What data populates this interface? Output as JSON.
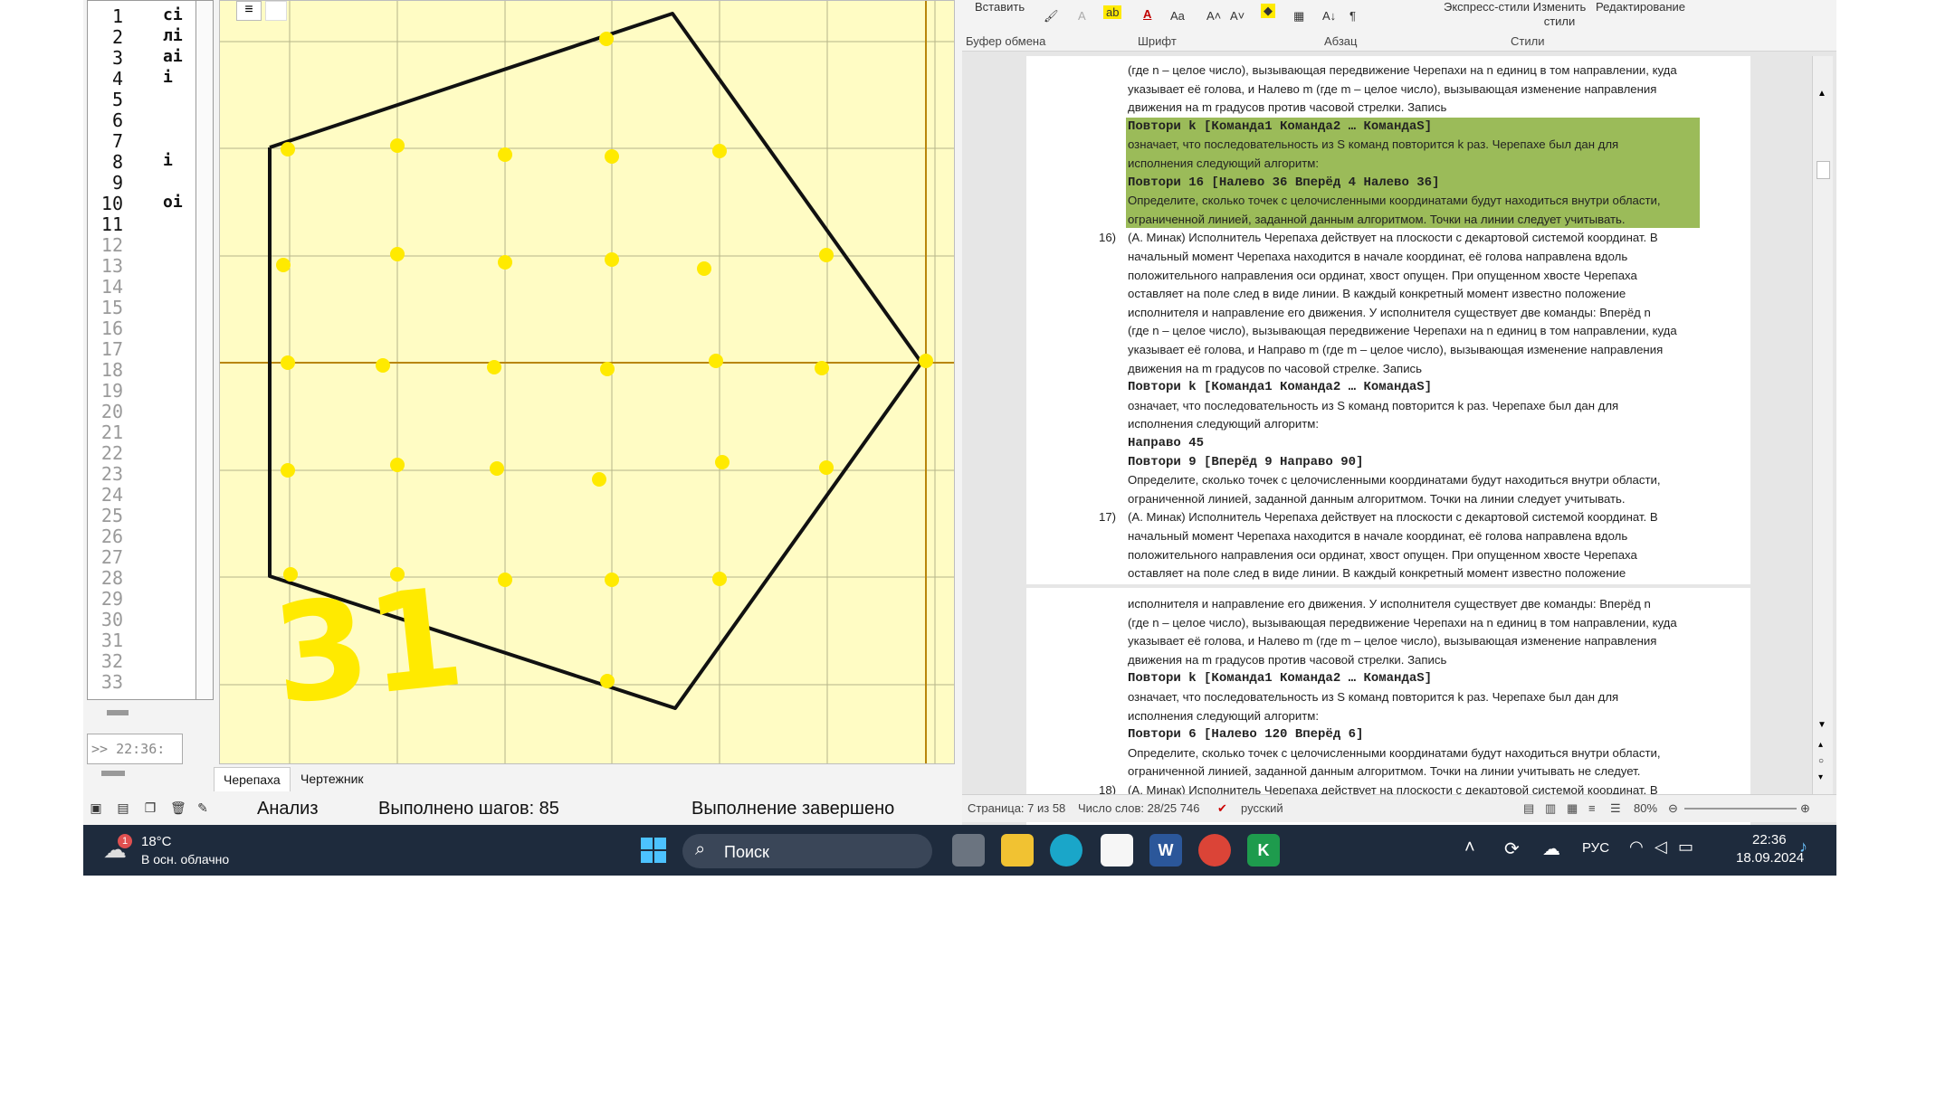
{
  "kumir": {
    "line_numbers": [
      "1",
      "2",
      "3",
      "4",
      "5",
      "6",
      "7",
      "8",
      "9",
      "10",
      "11",
      "12",
      "13",
      "14",
      "15",
      "16",
      "17",
      "18",
      "19",
      "20",
      "21",
      "22",
      "23",
      "24",
      "25",
      "26",
      "27",
      "28",
      "29",
      "30",
      "31",
      "32",
      "33"
    ],
    "code_fragments": [
      {
        "line": 1,
        "text": "сі"
      },
      {
        "line": 2,
        "text": "лі"
      },
      {
        "line": 3,
        "text": "аі"
      },
      {
        "line": 4,
        "text": "і"
      },
      {
        "line": 8,
        "text": "і"
      },
      {
        "line": 10,
        "text": "оі"
      }
    ],
    "console_text": ">> 22:36:",
    "tabs": [
      "Черепаха",
      "Чертежник"
    ],
    "status": {
      "mode": "Анализ",
      "steps": "Выполнено шагов: 85",
      "result": "Выполнение завершено"
    },
    "annotation": "31",
    "colors": {
      "canvas": "#fffcc4",
      "grid": "#b5b58a",
      "axis": "#b8860b",
      "dots": "#ffea00",
      "path": "#111111"
    }
  },
  "word": {
    "ribbon": {
      "paste": "Вставить",
      "groups": [
        "Буфер обмена",
        "Шрифт",
        "Абзац",
        "Стили",
        "Редактирование"
      ],
      "styles_express": "Экспресс-стили",
      "styles_change": "Изменить стили",
      "editing": "Редактирование"
    },
    "lines": [
      {
        "t": "(где n – целое число), вызывающая передвижение Черепахи на n единиц в том направлении, куда",
        "k": ""
      },
      {
        "t": "указывает её голова, и Налево m (где m – целое число), вызывающая изменение направления",
        "k": ""
      },
      {
        "t": "движения на m градусов против часовой стрелки. Запись",
        "k": ""
      },
      {
        "t": "  Повтори k [Команда1 Команда2 … КомандаS]",
        "k": "mono hl"
      },
      {
        "t": "означает, что последовательность из S команд повторится k раз. Черепахе был дан для",
        "k": "hl"
      },
      {
        "t": "исполнения следующий алгоритм:",
        "k": "hl"
      },
      {
        "t": "  Повтори 16 [Налево 36 Вперёд 4 Налево 36]",
        "k": "mono hl"
      },
      {
        "t": "Определите, сколько точек с целочисленными координатами будут находиться внутри области,",
        "k": "hl"
      },
      {
        "t": "ограниченной линией, заданной данным алгоритмом. Точки на линии следует учитывать.",
        "k": "hl"
      },
      {
        "t": "(А. Минак) Исполнитель Черепаха действует на плоскости с декартовой системой координат. В",
        "k": "",
        "n": "16)"
      },
      {
        "t": "начальный момент Черепаха находится в начале координат, её голова направлена вдоль",
        "k": ""
      },
      {
        "t": "положительного направления оси ординат, хвост опущен. При опущенном хвосте Черепаха",
        "k": ""
      },
      {
        "t": "оставляет на поле след в виде линии. В каждый конкретный момент известно положение",
        "k": ""
      },
      {
        "t": "исполнителя и направление его движения. У исполнителя существует две команды: Вперёд n",
        "k": ""
      },
      {
        "t": "(где n – целое число), вызывающая передвижение Черепахи на n единиц в том направлении, куда",
        "k": ""
      },
      {
        "t": "указывает её голова, и Направо m (где m – целое число), вызывающая изменение направления",
        "k": ""
      },
      {
        "t": "движения на m градусов по часовой стрелке. Запись",
        "k": ""
      },
      {
        "t": "  Повтори k [Команда1 Команда2 … КомандаS]",
        "k": "mono"
      },
      {
        "t": "означает, что последовательность из S команд повторится k раз. Черепахе был дан для",
        "k": ""
      },
      {
        "t": "исполнения следующий алгоритм:",
        "k": ""
      },
      {
        "t": "  Направо 45",
        "k": "mono"
      },
      {
        "t": "  Повтори 9 [Вперёд 9 Направо 90]",
        "k": "mono"
      },
      {
        "t": "Определите, сколько точек с целочисленными координатами будут находиться внутри области,",
        "k": ""
      },
      {
        "t": "ограниченной линией, заданной данным алгоритмом. Точки на линии следует учитывать.",
        "k": ""
      },
      {
        "t": "(А. Минак) Исполнитель Черепаха действует на плоскости с декартовой системой координат. В",
        "k": "",
        "n": "17)"
      },
      {
        "t": "начальный момент Черепаха находится в начале координат, её голова направлена вдоль",
        "k": ""
      },
      {
        "t": "положительного направления оси ординат, хвост опущен. При опущенном хвосте Черепаха",
        "k": ""
      },
      {
        "t": "оставляет на поле след в виде линии. В каждый конкретный момент известно положение",
        "k": ""
      }
    ],
    "lines_page2": [
      {
        "t": "исполнителя и направление его движения. У исполнителя существует две команды: Вперёд n",
        "k": ""
      },
      {
        "t": "(где n – целое число), вызывающая передвижение Черепахи на n единиц в том направлении, куда",
        "k": ""
      },
      {
        "t": "указывает её голова, и Налево m (где m – целое число), вызывающая изменение направления",
        "k": ""
      },
      {
        "t": "движения на m градусов против часовой стрелки. Запись",
        "k": ""
      },
      {
        "t": "  Повтори k [Команда1 Команда2 … КомандаS]",
        "k": "mono"
      },
      {
        "t": "означает, что последовательность из S команд повторится k раз. Черепахе был дан для",
        "k": ""
      },
      {
        "t": "исполнения следующий алгоритм:",
        "k": ""
      },
      {
        "t": "  Повтори 6 [Налево 120 Вперёд 6]",
        "k": "mono"
      },
      {
        "t": "Определите, сколько точек с целочисленными координатами будут находиться внутри области,",
        "k": ""
      },
      {
        "t": "ограниченной линией, заданной данным алгоритмом. Точки на линии учитывать не следует.",
        "k": ""
      },
      {
        "t": "(А. Минак) Исполнитель Черепаха действует на плоскости с декартовой системой координат. В",
        "k": "",
        "n": "18)"
      }
    ],
    "status": {
      "page": "Страница: 7 из 58",
      "words": "Число слов: 28/25 746",
      "lang": "русский",
      "zoom": "80%"
    }
  },
  "taskbar": {
    "weather_temp": "18°C",
    "weather_desc": "В осн. облачно",
    "weather_badge": "1",
    "search": "Поиск",
    "lang": "РУС",
    "time": "22:36",
    "date": "18.09.2024"
  }
}
